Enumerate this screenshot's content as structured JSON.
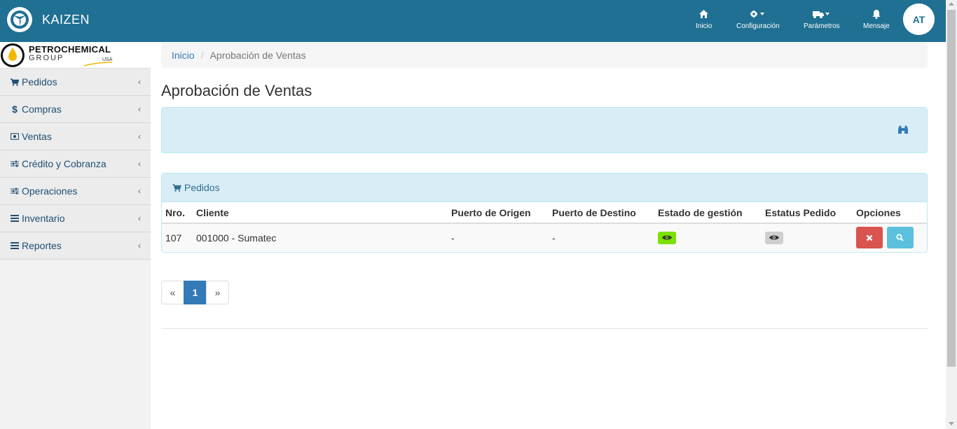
{
  "app": {
    "name": "KAIZEN"
  },
  "topnav": {
    "items": [
      {
        "label": "Inicio",
        "icon": "home-icon"
      },
      {
        "label": "Configuración",
        "icon": "gear-icon"
      },
      {
        "label": "Parámetros",
        "icon": "truck-icon"
      },
      {
        "label": "Mensaje",
        "icon": "bell-icon"
      }
    ],
    "avatar": "AT"
  },
  "sidebar": {
    "logo": {
      "line1": "PETROCHEMICAL",
      "line2": "GROUP",
      "line3": "USA"
    },
    "items": [
      {
        "label": "Pedidos",
        "icon": "cart-icon"
      },
      {
        "label": "Compras",
        "icon": "dollar-icon"
      },
      {
        "label": "Ventas",
        "icon": "money-icon"
      },
      {
        "label": "Crédito y Cobranza",
        "icon": "sliders-icon"
      },
      {
        "label": "Operaciones",
        "icon": "sliders-icon"
      },
      {
        "label": "Inventario",
        "icon": "list-icon"
      },
      {
        "label": "Reportes",
        "icon": "list-icon"
      }
    ]
  },
  "breadcrumb": {
    "home": "Inicio",
    "sep": "/",
    "current": "Aprobación de Ventas"
  },
  "page": {
    "title": "Aprobación de Ventas"
  },
  "orders": {
    "panel_title": "Pedidos",
    "columns": [
      "Nro.",
      "Cliente",
      "Puerto de Origen",
      "Puerto de Destino",
      "Estado de gestión",
      "Estatus Pedido",
      "Opciones"
    ],
    "rows": [
      {
        "nro": "107",
        "cliente": "001000 - Sumatec",
        "origen": "-",
        "destino": "-"
      }
    ]
  },
  "pagination": {
    "prev": "«",
    "current": "1",
    "next": "»"
  },
  "colors": {
    "navbar": "#1f7092",
    "green_badge": "#7ce000",
    "gray_badge": "#cfcfcf",
    "danger": "#d9534f",
    "info": "#5bc0de"
  }
}
